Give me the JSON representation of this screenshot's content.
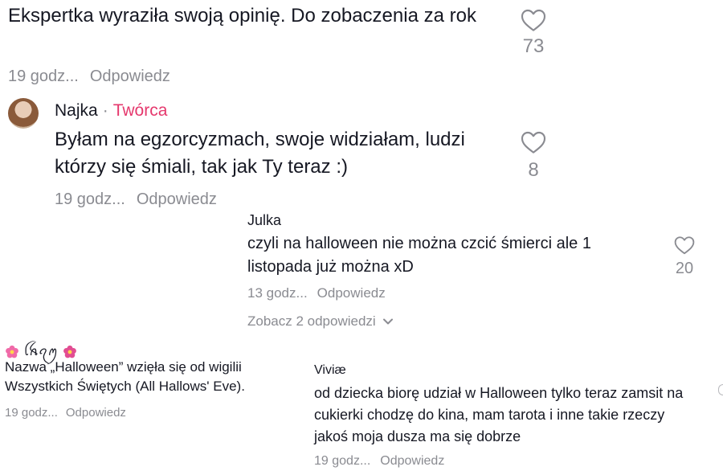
{
  "comments": {
    "top": {
      "text": "Ekspertka wyraziła swoją opinię. Do zobaczenia za rok",
      "time": "19 godz...",
      "reply": "Odpowiedz",
      "likes": "73"
    },
    "najka": {
      "username": "Najka",
      "separator": "·",
      "badge": "Twórca",
      "text": "Byłam na egzorcyzmach, swoje widziałam, ludzi którzy się śmiali, tak jak Ty teraz :)",
      "time": "19 godz...",
      "reply": "Odpowiedz",
      "likes": "8"
    },
    "julka": {
      "username": "Julka",
      "text": "czyli na halloween nie można czcić śmierci ale 1 listopada już można xD",
      "time": "13 godz...",
      "reply": "Odpowiedz",
      "likes": "20",
      "view_replies": "Zobacz 2 odpowiedzi"
    },
    "left": {
      "username": "ꪶꫝꪖꪑ",
      "text": "Nazwa „Halloween” wzięła się od wigilii Wszystkich Świętych (All Hallows' Eve).",
      "time": "19 godz...",
      "reply": "Odpowiedz"
    },
    "viviae": {
      "username": "Viviæ",
      "text": "od dziecka biorę udział w Halloween tylko teraz zamsit na cukierki chodzę do kina, mam tarota i inne takie rzeczy jakoś moja dusza ma się dobrze",
      "time": "19 godz...",
      "reply": "Odpowiedz"
    }
  },
  "icons": {
    "heart": "heart-outline-icon",
    "chevron": "chevron-down-icon",
    "flower": "flower-emoji-icon"
  },
  "colors": {
    "text": "#161823",
    "meta": "#8a8b91",
    "creator": "#e5386d",
    "flower": "#f06aa8"
  }
}
